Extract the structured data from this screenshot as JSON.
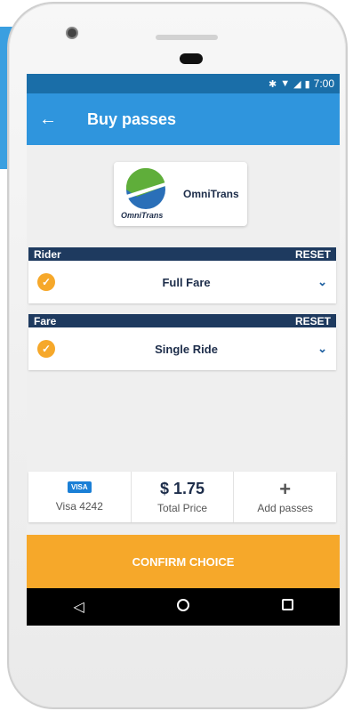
{
  "status": {
    "time": "7:00",
    "icons": [
      "bluetooth-icon",
      "wifi-icon",
      "signal-icon",
      "battery-icon"
    ]
  },
  "appbar": {
    "title": "Buy passes"
  },
  "agency": {
    "name": "OmniTrans",
    "logo_text": "OmniTrans"
  },
  "rider": {
    "header": "Rider",
    "reset": "RESET",
    "value": "Full Fare"
  },
  "fare": {
    "header": "Fare",
    "reset": "RESET",
    "value": "Single Ride"
  },
  "payment": {
    "card_badge": "VISA",
    "card_label": "Visa 4242"
  },
  "total": {
    "price": "$ 1.75",
    "label": "Total Price"
  },
  "add": {
    "symbol": "+",
    "label": "Add passes"
  },
  "confirm": {
    "label": "CONFIRM CHOICE"
  },
  "colors": {
    "primary": "#2f95dd",
    "status": "#1a6ea8",
    "accent": "#f6a82a",
    "header": "#1e3a5f"
  }
}
